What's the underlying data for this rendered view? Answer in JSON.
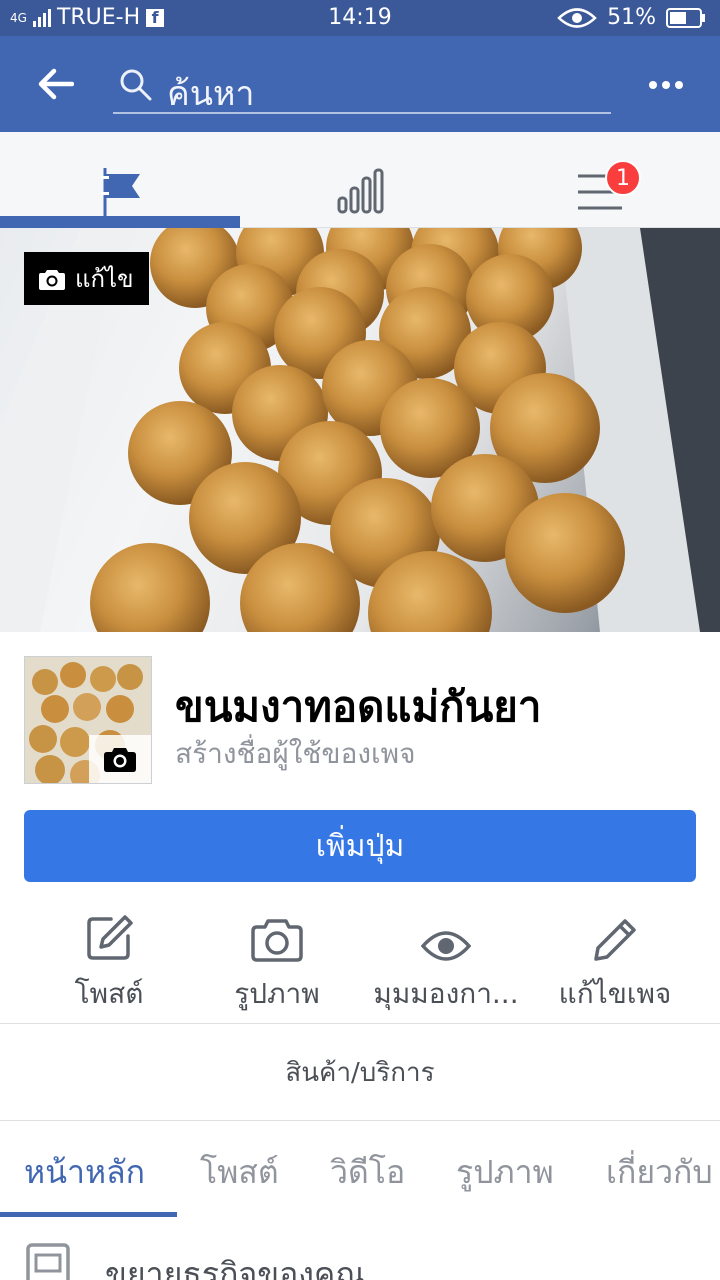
{
  "status_bar": {
    "network": "4G",
    "carrier": "TRUE-H",
    "time": "14:19",
    "battery": "51%"
  },
  "search": {
    "placeholder": "ค้นหา"
  },
  "notifications": {
    "badge_count": "1"
  },
  "cover": {
    "edit_label": "แก้ไข"
  },
  "page": {
    "name": "ขนมงาทอดแม่กันยา",
    "username_prompt": "สร้างชื่อผู้ใช้ของเพจ",
    "add_button": "เพิ่มปุ่ม"
  },
  "actions": [
    {
      "label": "โพสต์",
      "icon": "compose-icon"
    },
    {
      "label": "รูปภาพ",
      "icon": "camera-icon"
    },
    {
      "label": "มุมมองกา...",
      "icon": "eye-icon"
    },
    {
      "label": "แก้ไขเพจ",
      "icon": "pencil-icon"
    }
  ],
  "category": "สินค้า/บริการ",
  "sub_tabs": [
    "หน้าหลัก",
    "โพสต์",
    "วิดีโอ",
    "รูปภาพ",
    "เกี่ยวกับ"
  ],
  "promo": {
    "text": "ขยายธุรกิจของคุณ"
  },
  "colors": {
    "fb_blue": "#4267b2",
    "status_blue": "#3b5898",
    "button_blue": "#3578e5",
    "badge_red": "#fa3e3e"
  }
}
